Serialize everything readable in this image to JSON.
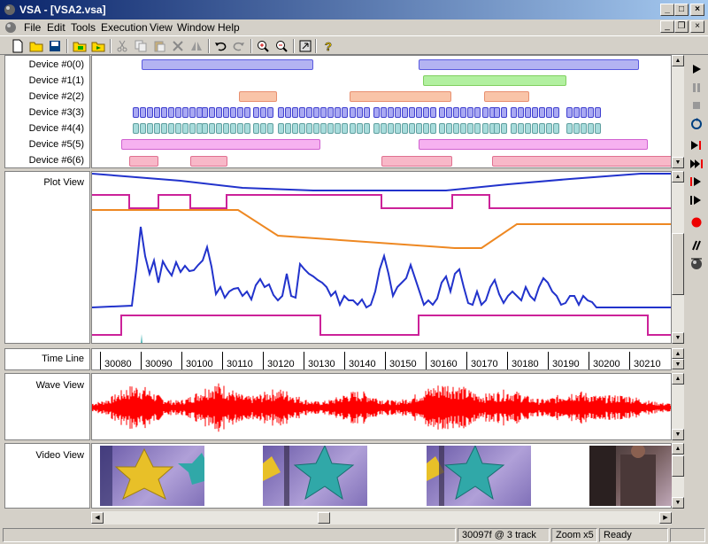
{
  "window": {
    "title": "VSA - [VSA2.vsa]"
  },
  "menu": [
    "File",
    "Edit",
    "Tools",
    "Execution",
    "View",
    "Window",
    "Help"
  ],
  "toolbar": [
    "new-icon",
    "open-icon",
    "save-icon",
    "tools-icon",
    "execute-icon",
    "cut-icon",
    "copy-icon",
    "paste-icon",
    "delete-icon",
    "mirror-icon",
    "undo-icon",
    "redo-icon",
    "zoom-in-icon",
    "zoom-out-icon",
    "export-icon",
    "help-icon"
  ],
  "devices": [
    "Device #0(0)",
    "Device #1(1)",
    "Device #2(2)",
    "Device #3(3)",
    "Device #4(4)",
    "Device #5(5)",
    "Device #6(6)"
  ],
  "views": {
    "plot": "Plot View",
    "timeline": "Time Line",
    "wave": "Wave View",
    "video": "Video View"
  },
  "timeline_ticks": [
    "30080",
    "30090",
    "30100",
    "30110",
    "30120",
    "30130",
    "30140",
    "30150",
    "30160",
    "30170",
    "30180",
    "30190",
    "30200",
    "30210"
  ],
  "status": {
    "frame": "30097f @ 3 track",
    "zoom": "Zoom x5",
    "state": "Ready"
  },
  "colors": {
    "device0": "#b3b3f2",
    "device1": "#b2f0a0",
    "device2": "#f9c4a8",
    "device3": "#a9a9f2",
    "device4": "#a8dcdc",
    "device5": "#f6b1f0",
    "device6": "#f8b8c8",
    "wave": "#ff0000",
    "plot_blue": "#2233cc",
    "plot_magenta": "#cc2299",
    "plot_orange": "#ee8822"
  }
}
